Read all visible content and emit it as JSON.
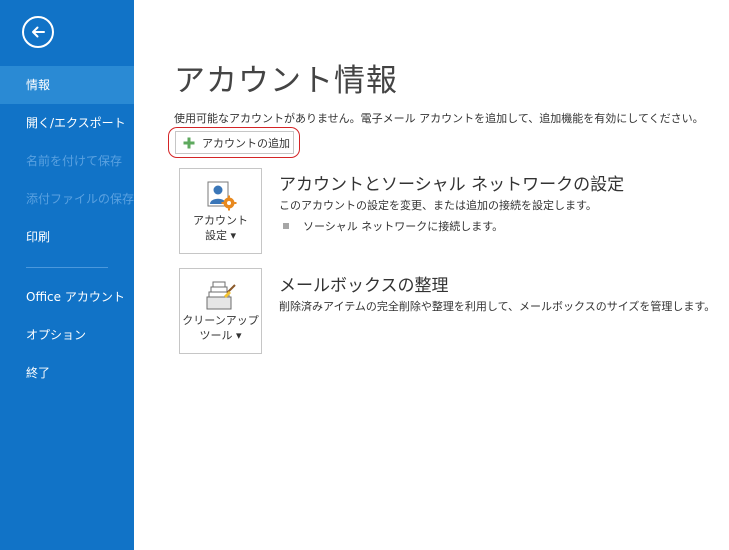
{
  "sidebar": {
    "back_label": "",
    "items": [
      {
        "label": "情報"
      },
      {
        "label": "開く/エクスポート"
      },
      {
        "label": "名前を付けて保存"
      },
      {
        "label": "添付ファイルの保存"
      },
      {
        "label": "印刷"
      },
      {
        "label": "Office アカウント"
      },
      {
        "label": "オプション"
      },
      {
        "label": "終了"
      }
    ],
    "colors": {
      "background": "#1173c7",
      "active": "#2a8ad4",
      "disabled_text": "#5aa1e0"
    }
  },
  "main": {
    "title": "アカウント情報",
    "description": "使用可能なアカウントがありません。電子メール アカウントを追加して、追加機能を有効にしてください。",
    "add_account_button": {
      "label": "アカウントの追加",
      "icon": "plus-icon"
    },
    "sections": [
      {
        "tile_label_1": "アカウント",
        "tile_label_2": "設定 ▾",
        "tile_icon": "account-settings-icon",
        "title": "アカウントとソーシャル ネットワークの設定",
        "description": "このアカウントの設定を変更、または追加の接続を設定します。",
        "bullet": "ソーシャル ネットワークに接続します。"
      },
      {
        "tile_label_1": "クリーンアップ",
        "tile_label_2": "ツール ▾",
        "tile_icon": "cleanup-tools-icon",
        "title": "メールボックスの整理",
        "description": "削除済みアイテムの完全削除や整理を利用して、メールボックスのサイズを管理します。"
      }
    ],
    "highlight_color": "#d42426"
  }
}
